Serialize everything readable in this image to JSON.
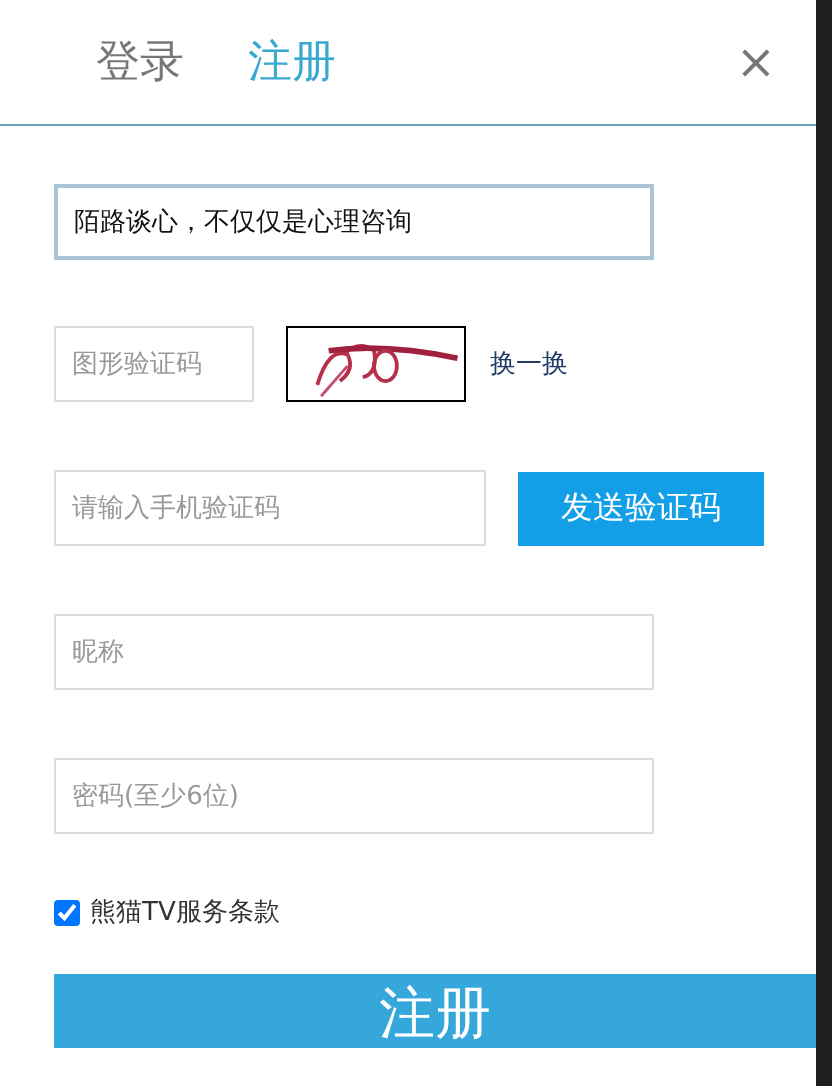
{
  "tabs": [
    {
      "label": "登录",
      "selected": false
    },
    {
      "label": "注册",
      "selected": true
    }
  ],
  "close": "×",
  "slogan_field": {
    "value": "陌路谈心，不仅仅是心理咨询"
  },
  "captcha": {
    "placeholder": "图形验证码",
    "refresh": "换一换"
  },
  "sms": {
    "placeholder": "请输入手机验证码",
    "button": "发送验证码"
  },
  "nickname": {
    "placeholder": "昵称"
  },
  "password": {
    "placeholder": "密码(至少6位)"
  },
  "terms": {
    "label": "熊猫TV服务条款",
    "checked": true
  },
  "submit": "注册"
}
